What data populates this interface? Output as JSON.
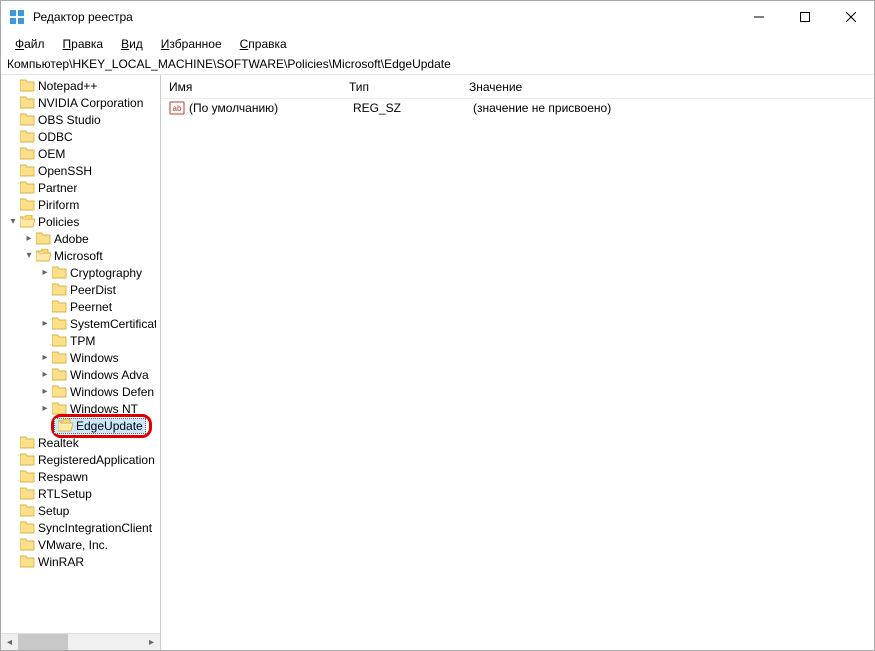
{
  "window": {
    "title": "Редактор реестра"
  },
  "menu": {
    "file": "Файл",
    "edit": "Правка",
    "view": "Вид",
    "favorites": "Избранное",
    "help": "Справка"
  },
  "address": "Компьютер\\HKEY_LOCAL_MACHINE\\SOFTWARE\\Policies\\Microsoft\\EdgeUpdate",
  "columns": {
    "name": "Имя",
    "type": "Тип",
    "data": "Значение"
  },
  "values": [
    {
      "name": "(По умолчанию)",
      "type": "REG_SZ",
      "data": "(значение не присвоено)"
    }
  ],
  "tree": {
    "level0": [
      {
        "label": "Notepad++"
      },
      {
        "label": "NVIDIA Corporation"
      },
      {
        "label": "OBS Studio"
      },
      {
        "label": "ODBC"
      },
      {
        "label": "OEM"
      },
      {
        "label": "OpenSSH"
      },
      {
        "label": "Partner"
      },
      {
        "label": "Piriform"
      },
      {
        "label": "Policies",
        "expanded": true
      }
    ],
    "policies_children": [
      {
        "label": "Adobe",
        "has_children": true
      },
      {
        "label": "Microsoft",
        "expanded": true,
        "has_children": true
      }
    ],
    "microsoft_children": [
      {
        "label": "Cryptography",
        "has_children": true
      },
      {
        "label": "PeerDist"
      },
      {
        "label": "Peernet"
      },
      {
        "label": "SystemCertificat",
        "has_children": true
      },
      {
        "label": "TPM"
      },
      {
        "label": "Windows",
        "has_children": true
      },
      {
        "label": "Windows Adva",
        "has_children": true
      },
      {
        "label": "Windows Defen",
        "has_children": true
      },
      {
        "label": "Windows NT",
        "has_children": true
      },
      {
        "label": "EdgeUpdate",
        "selected": true
      }
    ],
    "level0_after": [
      {
        "label": "Realtek"
      },
      {
        "label": "RegisteredApplication"
      },
      {
        "label": "Respawn"
      },
      {
        "label": "RTLSetup"
      },
      {
        "label": "Setup"
      },
      {
        "label": "SyncIntegrationClient"
      },
      {
        "label": "VMware, Inc."
      },
      {
        "label": "WinRAR"
      }
    ]
  }
}
